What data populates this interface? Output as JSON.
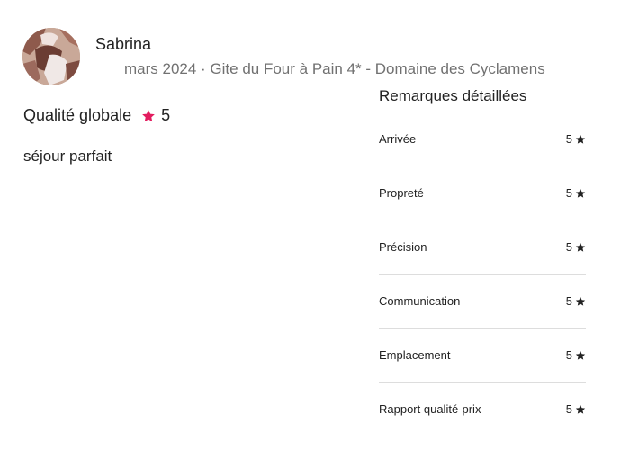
{
  "colors": {
    "accent_star": "#e31c5f",
    "text_primary": "#222222",
    "text_secondary": "#717171",
    "divider": "#dddddd"
  },
  "reviewer": {
    "name": "Sabrina",
    "meta": "mars 2024 · Gite du Four à Pain 4* - Domaine des Cyclamens",
    "avatar_icon": "user-photo"
  },
  "overall": {
    "label": "Qualité globale",
    "icon": "star-icon",
    "rating": "5"
  },
  "review": {
    "text": "séjour parfait"
  },
  "details": {
    "title": "Remarques détaillées",
    "items": [
      {
        "label": "Arrivée",
        "score": "5"
      },
      {
        "label": "Propreté",
        "score": "5"
      },
      {
        "label": "Précision",
        "score": "5"
      },
      {
        "label": "Communication",
        "score": "5"
      },
      {
        "label": "Emplacement",
        "score": "5"
      },
      {
        "label": "Rapport qualité-prix",
        "score": "5"
      }
    ]
  }
}
